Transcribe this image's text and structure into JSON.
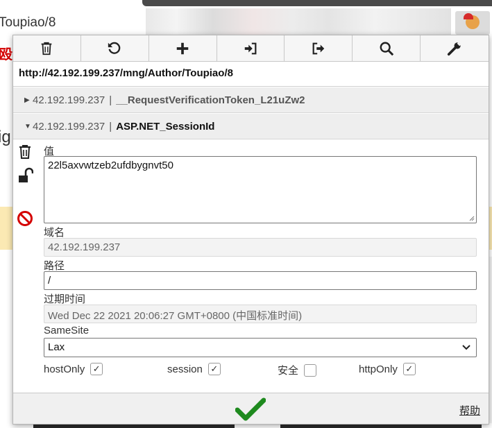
{
  "browser": {
    "tab_title": "Toupiao/8",
    "extension_icon": "cookie-santa-icon",
    "page_red_text": "殴",
    "page_side_text": "ig"
  },
  "toolbar": {
    "buttons": [
      {
        "name": "delete-all",
        "icon": "trash-icon"
      },
      {
        "name": "reset",
        "icon": "undo-icon"
      },
      {
        "name": "add",
        "icon": "plus-icon"
      },
      {
        "name": "import",
        "icon": "import-icon"
      },
      {
        "name": "export",
        "icon": "export-icon"
      },
      {
        "name": "search",
        "icon": "search-icon"
      },
      {
        "name": "options",
        "icon": "wrench-icon"
      }
    ]
  },
  "url": "http://42.192.199.237/mng/Author/Toupiao/8",
  "cookies": [
    {
      "domain": "42.192.199.237",
      "separator": "|",
      "name": "__RequestVerificationToken_L21uZw2",
      "expanded": false
    },
    {
      "domain": "42.192.199.237",
      "separator": "|",
      "name": "ASP.NET_SessionId",
      "expanded": true
    }
  ],
  "editor": {
    "value_label": "值",
    "value": "22l5axvwtzeb2ufdbygnvt50",
    "domain_label": "域名",
    "domain": "42.192.199.237",
    "path_label": "路径",
    "path": "/",
    "expires_label": "过期时间",
    "expires": "Wed Dec 22 2021 20:06:27 GMT+0800 (中国标准时间)",
    "samesite_label": "SameSite",
    "samesite": "Lax",
    "flags": {
      "hostonly_label": "hostOnly",
      "hostonly": true,
      "session_label": "session",
      "session": true,
      "secure_label": "安全",
      "secure": false,
      "httponly_label": "httpOnly",
      "httponly": true
    }
  },
  "footer": {
    "save_icon": "checkmark-icon",
    "help_label": "帮助"
  },
  "colors": {
    "accent_green": "#1e8a1e",
    "block_red": "#d40000"
  }
}
